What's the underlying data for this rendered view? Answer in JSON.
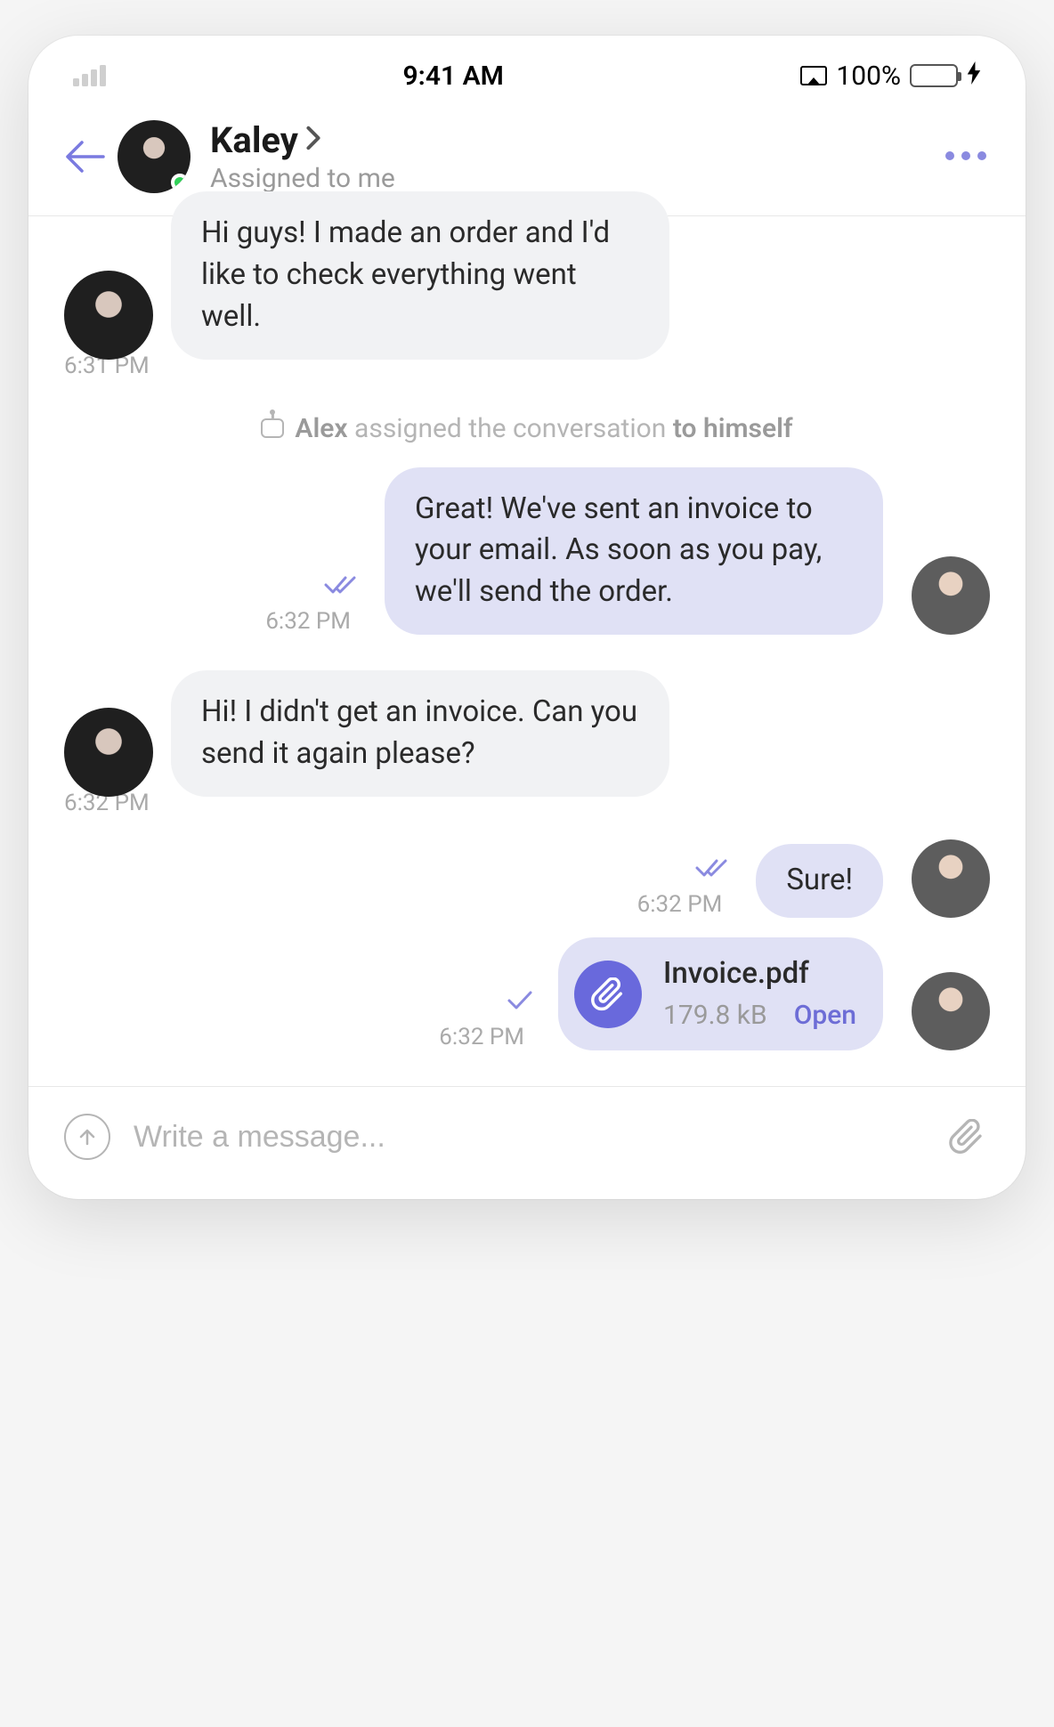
{
  "status_bar": {
    "time": "9:41 AM",
    "battery_pct": "100%"
  },
  "header": {
    "contact_name": "Kaley",
    "subtitle": "Assigned to me"
  },
  "messages": {
    "m1": {
      "text": "Hi guys! I made an order and I'd like to check everything went well.",
      "time": "6:31 PM"
    },
    "system1": {
      "actor": "Alex",
      "middle": "assigned the conversation",
      "target": "to himself"
    },
    "m2": {
      "text": "Great! We've sent an invoice to your email. As soon as you pay, we'll send the order.",
      "time": "6:32 PM"
    },
    "m3": {
      "text": "Hi! I didn't get an invoice. Can you send it again please?",
      "time": "6:32 PM"
    },
    "m4": {
      "text": "Sure!",
      "time": "6:32 PM"
    },
    "m5": {
      "file_name": "Invoice.pdf",
      "file_size": "179.8 kB",
      "open_label": "Open",
      "time": "6:32 PM"
    }
  },
  "composer": {
    "placeholder": "Write a message..."
  }
}
